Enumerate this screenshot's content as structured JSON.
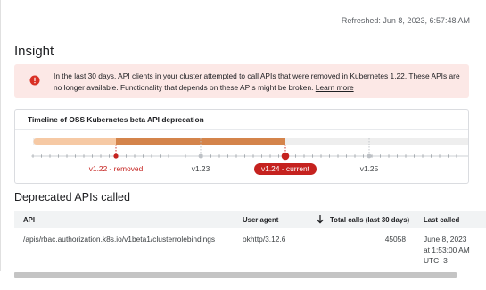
{
  "header": {
    "refreshed": "Refreshed: Jun 8, 2023, 6:57:48 AM"
  },
  "insight": {
    "title": "Insight",
    "alert_text": "In the last 30 days, API clients in your cluster attempted to call APIs that were removed in Kubernetes 1.22. These APIs are no longer available. Functionality that depends on these APIs might be broken.",
    "learn_more": "Learn more",
    "alert_color": "#d93025"
  },
  "timeline": {
    "title": "Timeline of OSS Kubernetes beta API deprecation",
    "labels": {
      "removed": "v1.22 - removed",
      "v123": "v1.23",
      "current": "v1.24 - current",
      "v125": "v1.25"
    },
    "colors": {
      "past": "#f6c9a4",
      "removed_span": "#d4844b",
      "future": "#eeeeee",
      "marker": "#c5221f"
    }
  },
  "deprecated_apis": {
    "title": "Deprecated APIs called",
    "columns": {
      "api": "API",
      "user_agent": "User agent",
      "total_calls": "Total calls (last 30 days)",
      "last_called": "Last called"
    },
    "sort_icon": "arrow-down-icon",
    "rows": [
      {
        "api": "/apis/rbac.authorization.k8s.io/v1beta1/clusterrolebindings",
        "user_agent": "okhttp/3.12.6",
        "total_calls": "45058",
        "last_called_1": "June 8, 2023",
        "last_called_2": "at 1:53:00 AM",
        "last_called_3": "UTC+3"
      }
    ]
  }
}
